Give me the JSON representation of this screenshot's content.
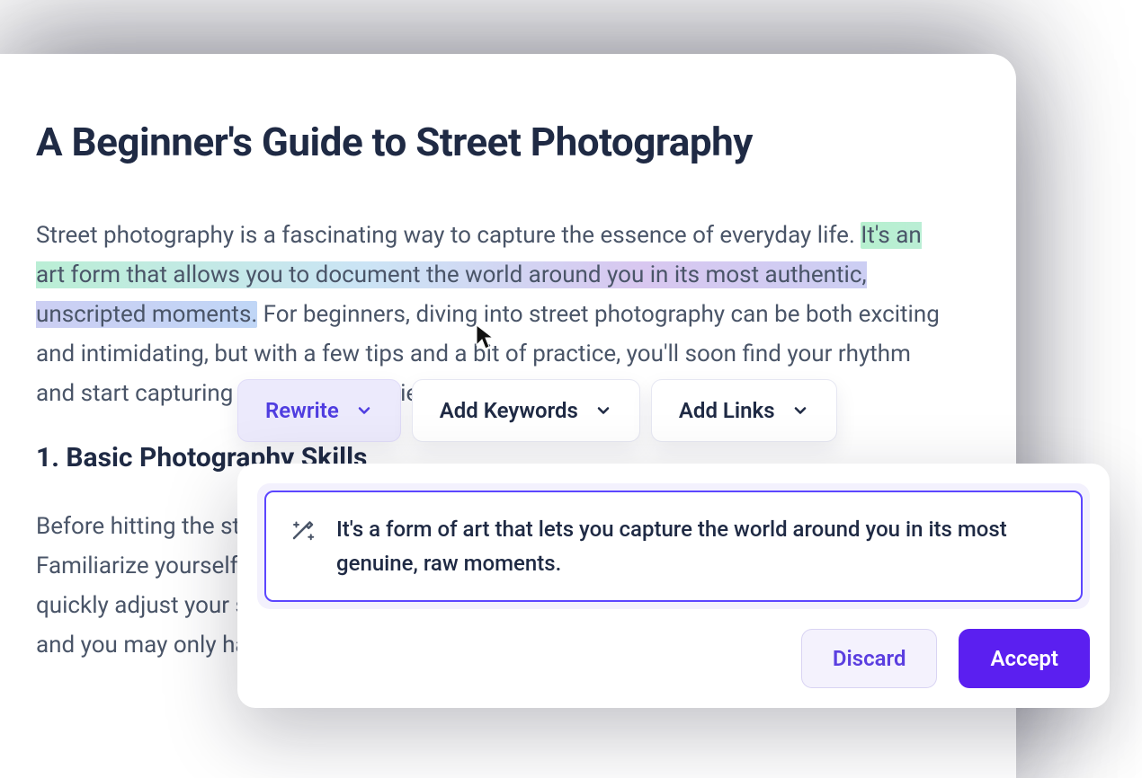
{
  "document": {
    "title": "A Beginner's Guide to Street Photography",
    "para1_pre": "Street photography is a fascinating way to capture the essence of everyday life. ",
    "para1_highlight": "It's an art form that allows you to document the world around you in its most authentic, unscripted moments.",
    "para1_post": " For beginners, diving into street photography can be both exciting and intimidating, but with a few tips and a bit of practice, you'll soon find your rhythm and start capturing compelling stories on the street.",
    "section1_heading": "1. Basic Photography Skills",
    "para2": "Before hitting the streets, it's essential to have a solid understanding of photography. Familiarize yourself with your camera's settings, exposure, and lighting. Knowing how to quickly adjust your settings is key in street photography, where the action happens fast and you may only have seconds to capture the perfect shot."
  },
  "toolbar": {
    "rewrite_label": "Rewrite",
    "add_keywords_label": "Add Keywords",
    "add_links_label": "Add Links"
  },
  "suggestion": {
    "text": "It's a form of art that lets you capture the world around you in its most genuine, raw moments."
  },
  "actions": {
    "discard_label": "Discard",
    "accept_label": "Accept"
  }
}
